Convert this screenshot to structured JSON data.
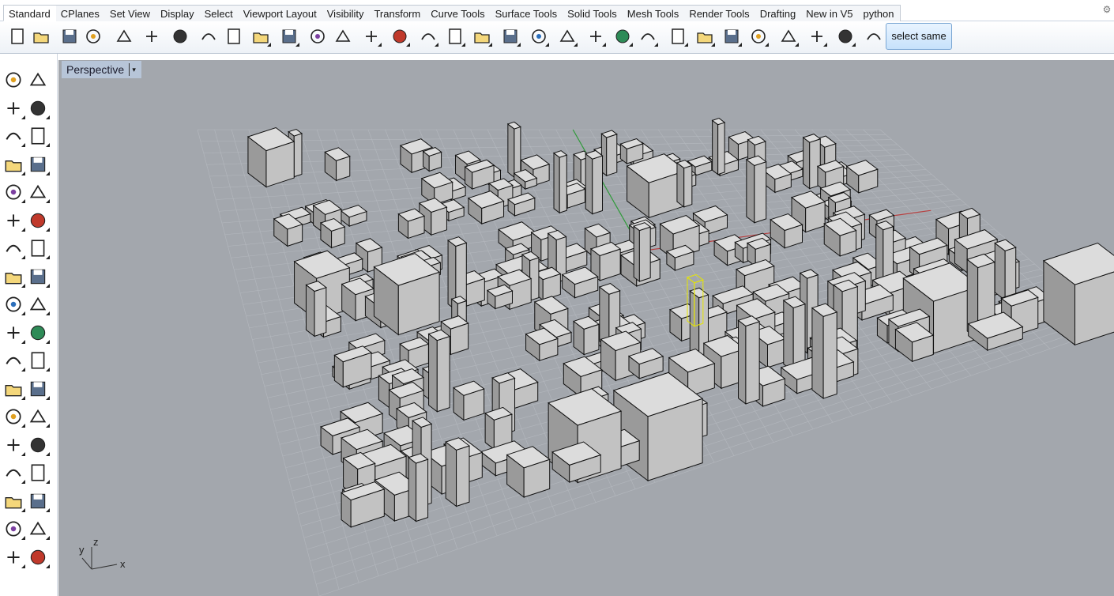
{
  "tabs": [
    {
      "label": "Standard",
      "active": true
    },
    {
      "label": "CPlanes"
    },
    {
      "label": "Set View"
    },
    {
      "label": "Display"
    },
    {
      "label": "Select"
    },
    {
      "label": "Viewport Layout"
    },
    {
      "label": "Visibility"
    },
    {
      "label": "Transform"
    },
    {
      "label": "Curve Tools"
    },
    {
      "label": "Surface Tools"
    },
    {
      "label": "Solid Tools"
    },
    {
      "label": "Mesh Tools"
    },
    {
      "label": "Render Tools"
    },
    {
      "label": "Drafting"
    },
    {
      "label": "New in V5"
    },
    {
      "label": "python"
    }
  ],
  "toolbar": {
    "select_same_label": "select same",
    "icons": [
      "new-file-icon",
      "open-folder-icon",
      "save-icon",
      "print-icon",
      "import-icon",
      "cut-icon",
      "copy-icon",
      "paste-icon",
      "undo-icon",
      "pan-hand-icon",
      "rotate-view-icon",
      "zoom-icon",
      "zoom-window-icon",
      "zoom-extents-icon",
      "zoom-selected-icon",
      "rotate-camera-icon",
      "viewport-layout-icon",
      "car-icon",
      "cplane-icon",
      "osnap-icon",
      "dimension-icon",
      "light-bulb-icon",
      "lock-icon",
      "layer-icon",
      "color-wheel-icon",
      "shaded-sphere-icon",
      "rendered-sphere-icon",
      "render-icon",
      "material-icon",
      "options-gear-icon",
      "grid-snap-icon",
      "help-icon"
    ]
  },
  "left_tools": [
    "select-arrow-icon",
    "point-icon",
    "polyline-icon",
    "curve-icon",
    "circle-icon",
    "ellipse-icon",
    "polygon-icon",
    "rectangle-icon",
    "arc-icon",
    "fillet-icon",
    "surface-icon",
    "loft-icon",
    "box-solid-icon",
    "sphere-solid-icon",
    "cylinder-icon",
    "mesh-icon",
    "explode-icon",
    "trim-icon",
    "split-icon",
    "join-icon",
    "group-icon",
    "array-icon",
    "offset-icon",
    "curve-blend-icon",
    "text-icon",
    "scale-icon",
    "block-icon",
    "edit-icon",
    "extrude-icon",
    "distribute-icon",
    "grid-array-icon",
    "align-icon",
    "mirror-icon",
    "check-icon",
    "shell-icon",
    "analyze-icon"
  ],
  "viewport": {
    "title": "Perspective",
    "menu_arrow": "▾",
    "axis_labels": {
      "x": "x",
      "y": "y",
      "z": "z"
    }
  },
  "colors": {
    "viewport_bg": "#a3a7ad",
    "grid": "#b4b8be",
    "box_top": "#dcdcdc",
    "box_left": "#9a9a9a",
    "box_right": "#c2c2c2",
    "edge": "#111111",
    "selected": "#e6e600",
    "x_axis": "#b84040",
    "y_axis": "#2f9a3a"
  }
}
